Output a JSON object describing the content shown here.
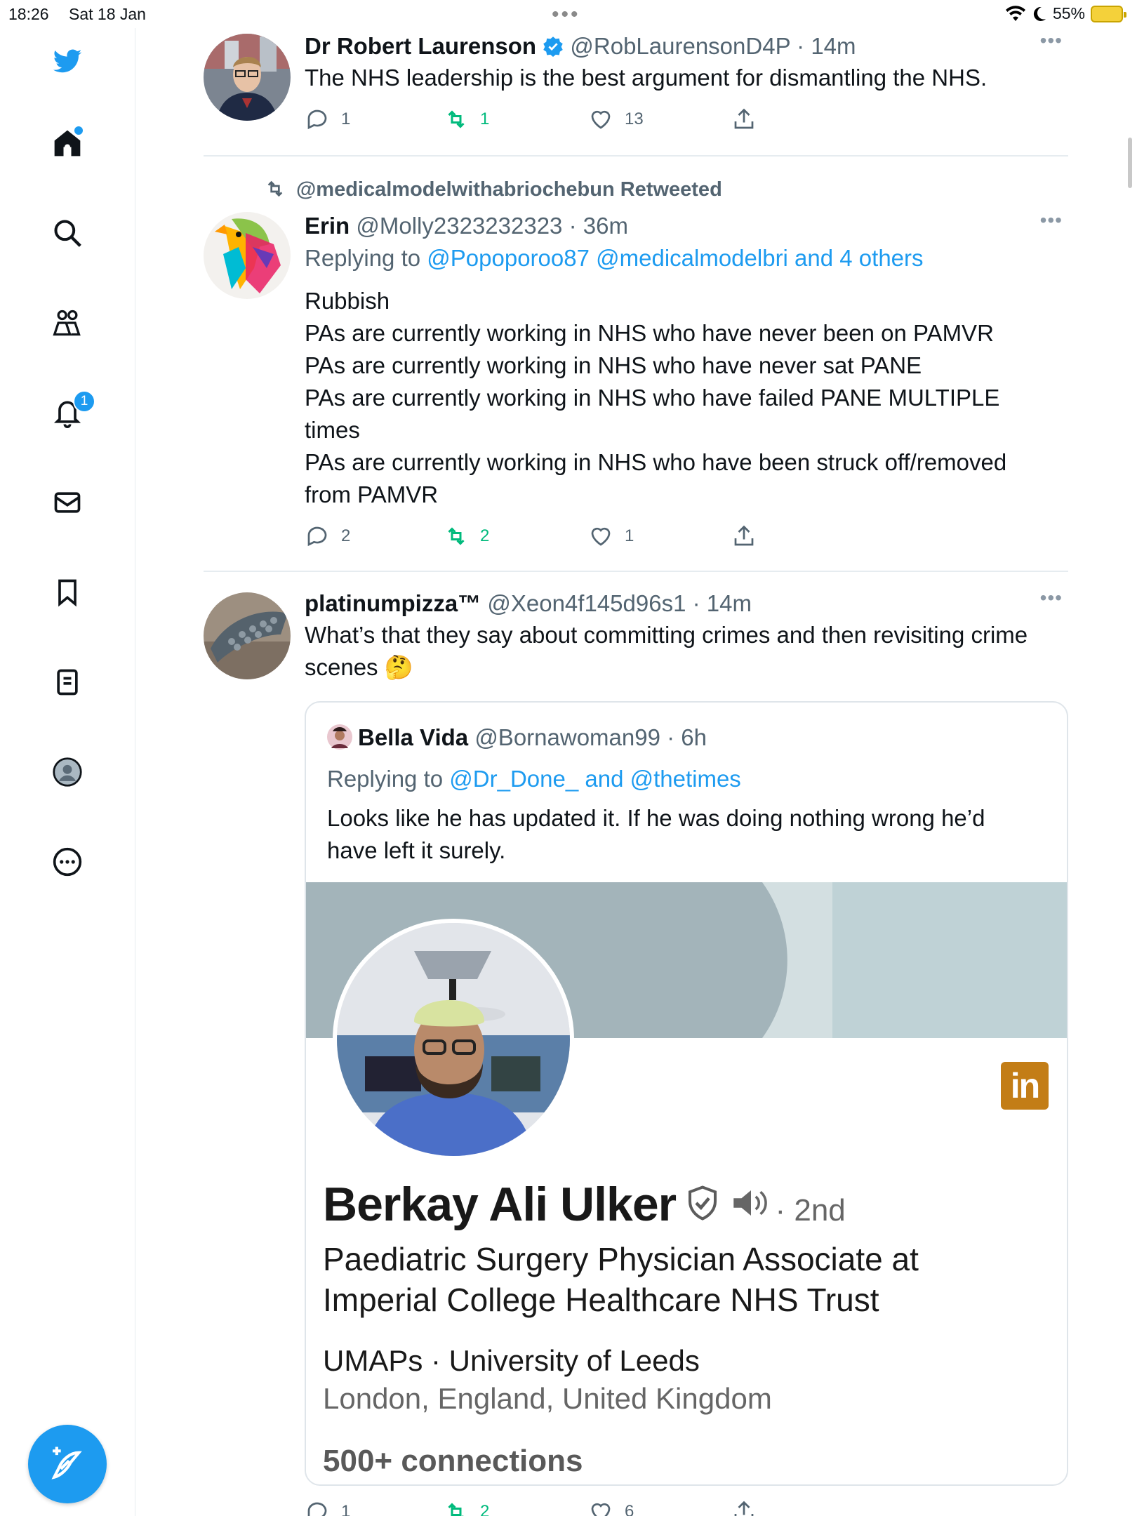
{
  "status_bar": {
    "time": "18:26",
    "date": "Sat 18 Jan",
    "battery": "55%"
  },
  "sidebar": {
    "notifications_badge": "1",
    "items": [
      "home-icon",
      "search-icon",
      "communities-icon",
      "notifications-icon",
      "messages-icon",
      "bookmarks-icon",
      "lists-icon",
      "profile-icon",
      "more-icon"
    ]
  },
  "tweets": [
    {
      "name": "Dr Robert Laurenson",
      "handle": "@RobLaurensonD4P",
      "time": "14m",
      "text": "The NHS leadership is the best argument for dismantling the NHS.",
      "replies": "1",
      "retweets": "1",
      "likes": "13"
    },
    {
      "retweeted_by": "@medicalmodelwithabriochebun Retweeted",
      "name": "Erin",
      "handle": "@Molly2323232323",
      "time": "36m",
      "replying_prefix": "Replying to",
      "replying_to": "@Popoporoo87 @medicalmodelbri and 4 others",
      "lines": [
        "Rubbish",
        "PAs are currently working in NHS who have never been on PAMVR",
        "PAs are currently working in NHS who have never sat PANE",
        "PAs are currently working in NHS who have failed PANE MULTIPLE",
        "times",
        "PAs are currently working in NHS who have been struck off/removed",
        "from PAMVR"
      ],
      "replies": "2",
      "retweets": "2",
      "likes": "1"
    },
    {
      "name": "platinumpizza™",
      "handle": "@Xeon4f145d96s1",
      "time": "14m",
      "text_line1": "What’s that they say about committing crimes and then revisiting crime",
      "text_line2": "scenes",
      "emoji": "🤔",
      "replies": "1",
      "retweets": "2",
      "likes": "6",
      "quote": {
        "name": "Bella Vida",
        "handle": "@Bornawoman99",
        "time": "6h",
        "replying_prefix": "Replying to",
        "replying_to": "@Dr_Done_ and @thetimes",
        "text_line1": "Looks like he has updated it. If he was doing nothing wrong he’d",
        "text_line2": "have left it surely.",
        "linkedin": {
          "logo": "in",
          "name": "Berkay Ali Ulker",
          "degree": "· 2nd",
          "headline_line1": "Paediatric Surgery Physician Associate at",
          "headline_line2": "Imperial College Healthcare NHS Trust",
          "education": "UMAPs · University of Leeds",
          "location": "London, England, United Kingdom",
          "connections": "500+ connections"
        }
      }
    }
  ],
  "colors": {
    "accent": "#1d9bf0",
    "retweet_green": "#00ba7c",
    "linkedin_gold": "#c37d16"
  }
}
